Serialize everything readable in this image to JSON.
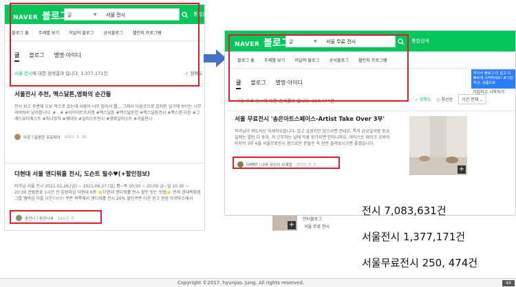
{
  "left_screenshot": {
    "logo_naver": "NAVER",
    "logo_blog": "블로그",
    "search_category": "글",
    "search_query": "서울 전시",
    "integrated_search_label": "통합검색",
    "menu": [
      "블로그 홈",
      "주제별 보기",
      "이달의 블로그",
      "공식블로그",
      "챌린지 프로그램"
    ],
    "tabs": [
      "글",
      "블로그",
      "별명·아이디"
    ],
    "result_highlight": "서울 전시",
    "result_suffix": "에 대한 검색결과 입니다.",
    "result_count": "1,377,171건",
    "accuracy_label": "✓ 정확도",
    "post1_title": "서울전시 추천, 맥스달튼,영화의 순간들",
    "post1_text": "전시 보고 주변에 도보 먹으로 갔는데 사람이 너무 많아서 웹... 그래서 다음곳으로 갔지만 입구에 보이는 너무 귀여워서 남겨봅니다. # . # #아이아트프지엠 #맥스달튼 #맥스달튼전 #맥스달튼전시 #맥스덴 다운 #그래드뷰티에스트 #지니뮤직 #웨이브 #일러스트전시 #영화일러스트 #서울전시",
    "post1_author": "마온",
    "post1_blog": "달콤한 유료피아",
    "post1_date": "2021. 5. 30.",
    "post2_title": "더현대 서울 앤디워홀 전시, 도슨트 필수♥(+할인정보)",
    "post2_text": "비가님 서울 전시 2021.02.26.(금) ~ 2021.06.27.(일) 평~목 10:30 ~ 20:00 금~일 10:30 ~ 20:30 관람종료 1시간 전 입장마감 더현대 6층 ⭐더현대 앤디워홀 전시 할인 받는 방법⭐ 먼저 현대백화점그룹 멤버십 어플 다운!!!!!!! 쿠폰 목록에서 앤디워홀 전시 20% 할인쿠폰 다운 받고 현장 티켓부스에서",
    "post2_author": "송언니",
    "post2_blog": "송언니네",
    "post2_date": "19시간 전",
    "sidebar_items": [
      "이대표가 추천드립니다",
      "인터블로그",
      "서울 무료 전시"
    ]
  },
  "right_screenshot": {
    "logo_naver": "NAVER",
    "logo_blog": "블로그",
    "search_category": "글",
    "search_query": "서울 무료 전시",
    "integrated_search_label": "통합검색",
    "menu": [
      "블로그 홈",
      "주제별 보기",
      "이달의 블로그",
      "공식블로그",
      "챌린지 프로그램"
    ],
    "tabs": [
      "글",
      "블로그",
      "별명·아이디"
    ],
    "result_highlight": "서울 무료 전시",
    "result_suffix": "에 대한 검색결과 입니다.",
    "result_count": "250,474건",
    "accuracy_label": "✓ 정확도",
    "latest_label": "○ 최신순",
    "period_label": "기간 전체 ⌄",
    "ad_text": "여기서 블로그 더 쉽고 더 빠르게 시작하세요! 로그인하고, 상품으로",
    "ad_button": "가입하고 시작하기",
    "post_title": "서울 무료전시 '송은아트스페이스-Artist Take Over 3부'",
    "post_text": "작가님이 의도하신 자세히요합니다. 앉고 실경치만 앉으시면 인테요. 특히 금요일이랑 토요일에는 열만 다 둥라, 저 근무하는 날에 작품 망가지면 안되니까요. 아티스트 테이크 오버의 마지막 3부 6월 서울무료전시 참으로만 분들은 꼭 한번 들려보시으면 좋겠습니다.",
    "post_author": "GABO",
    "post_blog": "나와 당신의 사계절",
    "post_date": "2021. 6. 3."
  },
  "annotations": [
    "전시 7,083,631건",
    "서울전시 1,377,171건",
    "서울무료전시 250, 474건"
  ],
  "footer_text": "Copyright ©2017. hyunjoo. Jung. All rights reserved.",
  "page_badge": "44",
  "colors": {
    "naver_green": "#03c75a",
    "highlight_red": "#e11a2b",
    "arrow_blue": "#4472c4"
  }
}
